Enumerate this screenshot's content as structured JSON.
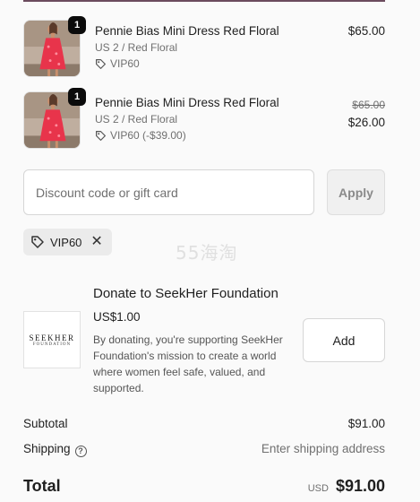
{
  "items": [
    {
      "quantity": "1",
      "name": "Pennie Bias Mini Dress Red Floral",
      "variant": "US 2 / Red Floral",
      "discount": "VIP60",
      "price": "$65.00"
    },
    {
      "quantity": "1",
      "name": "Pennie Bias Mini Dress Red Floral",
      "variant": "US 2 / Red Floral",
      "discount": "VIP60 (-$39.00)",
      "price_original": "$65.00",
      "price": "$26.00"
    }
  ],
  "discount_form": {
    "placeholder": "Discount code or gift card",
    "value": "",
    "apply_label": "Apply"
  },
  "applied_code": {
    "code": "VIP60",
    "remove_icon": "close-icon"
  },
  "watermark": "55海淘",
  "donation": {
    "title": "Donate to SeekHer Foundation",
    "logo_text": "SEEKHER",
    "logo_subtext": "FOUNDATION",
    "amount": "US$1.00",
    "description": "By donating, you're supporting SeekHer Foundation's mission to create a world where women feel safe, valued, and supported.",
    "add_label": "Add"
  },
  "summary": {
    "subtotal_label": "Subtotal",
    "subtotal_value": "$91.00",
    "shipping_label": "Shipping",
    "shipping_value": "Enter shipping address",
    "total_label": "Total",
    "currency": "USD",
    "total_value": "$91.00"
  },
  "colors": {
    "accent_rule": "#6b4b5e",
    "badge": "#0b0b0b",
    "dress": "#e8344b"
  }
}
